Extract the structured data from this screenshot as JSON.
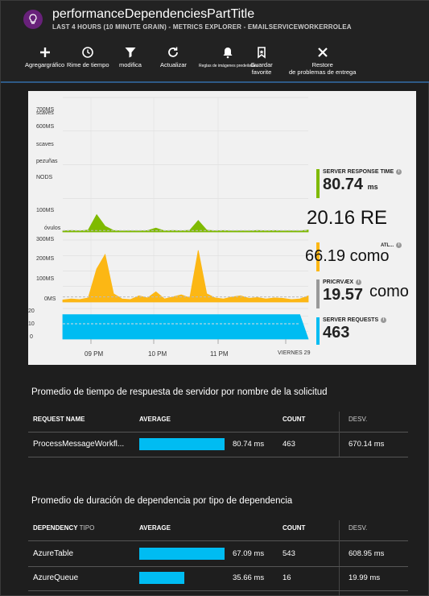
{
  "header": {
    "title": "performanceDependenciesPartTitle",
    "subtitle": "LAST 4 HOURS (10 MINUTE GRAIN) - METRICS EXPLORER - EMAILSERVICEWORKERROLEA"
  },
  "toolbar": {
    "add_chart": "Agregargráfico",
    "time_range": "Rime de tiempo",
    "filter": "modifica",
    "refresh": "Actualizar",
    "alert_rules": "Reglas de imágenes predeiladas",
    "save_favorite": "Guardar favorite",
    "reset_line1": "Restore",
    "reset_line2": "de problemas de entrega"
  },
  "chart": {
    "top_y_labels": [
      "scaves",
      "700MS",
      "600MS",
      "scaves",
      "pezuñas",
      "NODS",
      "100MS",
      "óvulos"
    ],
    "mid_y_labels": [
      "300MS",
      "200MS",
      "100MS",
      "0MS"
    ],
    "bot_y_labels": [
      "20",
      "10",
      "0"
    ],
    "x_labels": [
      "09 PM",
      "10 PM",
      "11 PM",
      "VIERNES 29"
    ],
    "legend": [
      {
        "name": "SERVER RESPONSE TIME",
        "value": "80.74",
        "unit": "ms",
        "color": "#7fba00"
      },
      {
        "name": "ATL...",
        "value": "",
        "unit": "",
        "color": "#fcb714"
      },
      {
        "name": "PRICRVÆX",
        "value": "19.57",
        "unit": "",
        "color": "#999999"
      },
      {
        "name": "SERVER REQUESTS",
        "value": "463",
        "unit": "",
        "color": "#00bcf2"
      }
    ],
    "overlay_1": "20.16 RE",
    "overlay_2": "66.19 como",
    "overlay_3": "como"
  },
  "chart_data": [
    {
      "type": "area",
      "title": "",
      "series": [
        {
          "name": "SERVER RESPONSE TIME",
          "values": [
            5,
            8,
            6,
            10,
            90,
            30,
            8,
            5,
            6,
            5,
            7,
            20,
            6,
            8,
            6,
            9,
            60,
            10,
            6,
            7,
            5,
            6,
            5,
            8,
            6,
            7,
            5,
            6,
            5,
            10
          ]
        }
      ],
      "ylabel_unit": "ms",
      "ylim": [
        0,
        700
      ]
    },
    {
      "type": "area",
      "series": [
        {
          "name": "ATL...",
          "values": [
            10,
            15,
            12,
            20,
            160,
            230,
            40,
            15,
            12,
            30,
            20,
            50,
            15,
            25,
            35,
            20,
            250,
            40,
            20,
            15,
            25,
            30,
            18,
            22,
            15,
            20,
            18,
            12,
            15,
            30
          ]
        }
      ],
      "ylim": [
        0,
        300
      ]
    },
    {
      "type": "area",
      "series": [
        {
          "name": "SERVER REQUESTS",
          "values": [
            16,
            16,
            16,
            16,
            16,
            16,
            16,
            16,
            16,
            16,
            16,
            16,
            16,
            16,
            16,
            16,
            16,
            16,
            16,
            16,
            16,
            16,
            16,
            16,
            16,
            16,
            16,
            16,
            16,
            0
          ]
        }
      ],
      "ylim": [
        0,
        20
      ]
    }
  ],
  "table1": {
    "title": "Promedio de tiempo de respuesta de servidor por nombre de la solicitud",
    "headers": {
      "name": "REQUEST NAME",
      "avg": "AVERAGE",
      "count": "COUNT",
      "dev": "DESV."
    },
    "rows": [
      {
        "name": "ProcessMessageWorkfl...",
        "avg": "80.74 ms",
        "avg_fraction": 1.0,
        "count": "463",
        "dev": "670.14 ms"
      }
    ]
  },
  "table2": {
    "title": "Promedio de duración de dependencia por tipo de dependencia",
    "headers": {
      "name": "DEPENDENCY",
      "name_sub": "TIPO",
      "avg": "AVERAGE",
      "count": "COUNT",
      "dev": "DESV."
    },
    "rows": [
      {
        "name": "AzureTable",
        "avg": "67.09 ms",
        "avg_fraction": 1.0,
        "count": "543",
        "dev": "608.95 ms"
      },
      {
        "name": "AzureQueue",
        "avg": "35.66 ms",
        "avg_fraction": 0.53,
        "count": "16",
        "dev": "19.99 ms"
      }
    ]
  }
}
